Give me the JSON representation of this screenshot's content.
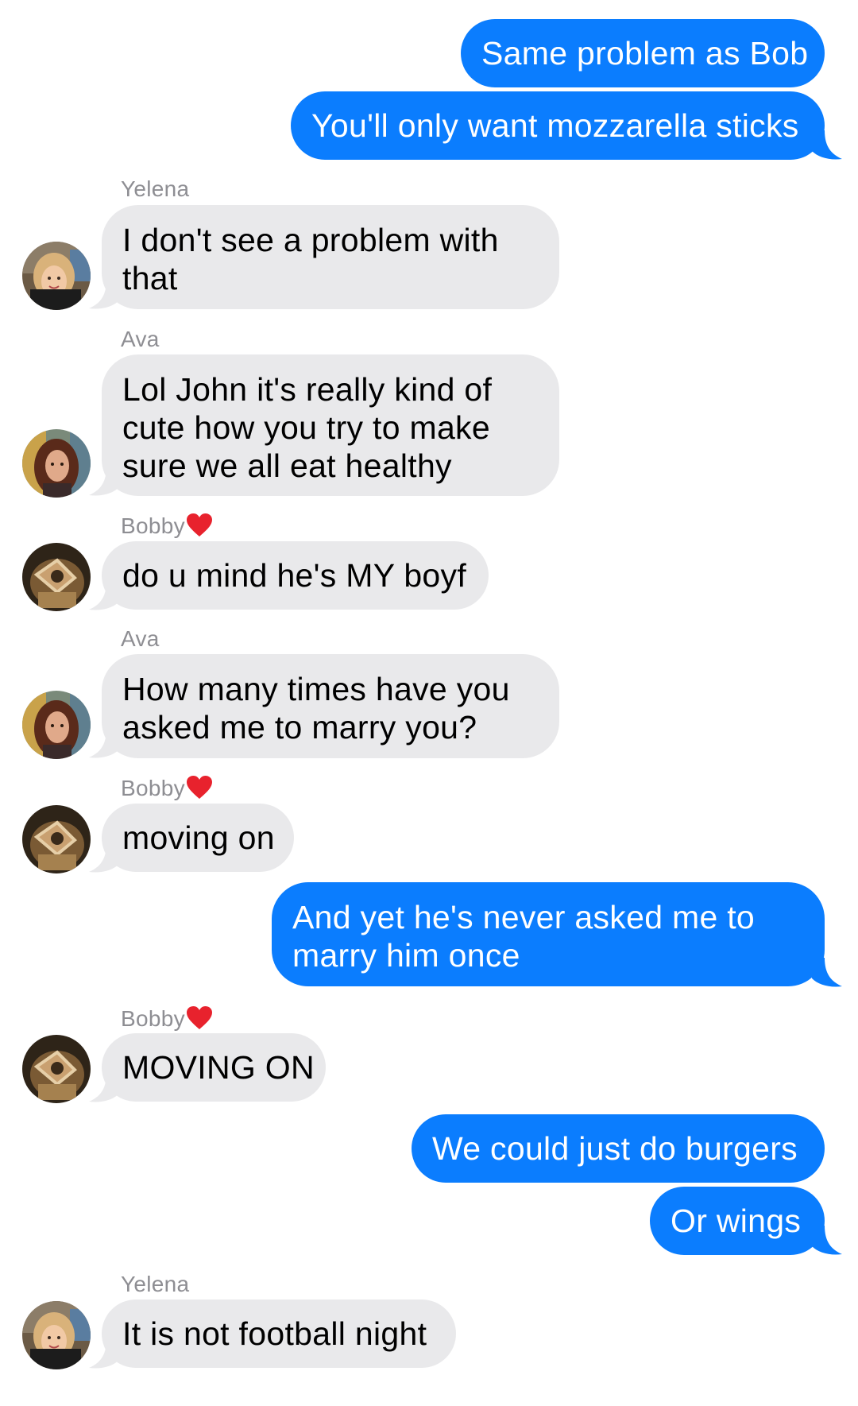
{
  "colors": {
    "outgoing_bubble": "#0b7dfe",
    "incoming_bubble": "#e9e9eb",
    "sender_name": "#8e8e93",
    "heart": "#e8222d"
  },
  "messages": [
    {
      "direction": "out",
      "text": "Same problem as Bob"
    },
    {
      "direction": "out",
      "text": "You'll only want mozzarella sticks"
    },
    {
      "direction": "in",
      "sender": "Yelena",
      "avatar": "yelena-avatar",
      "lines": [
        "I don't see a problem with",
        "that"
      ]
    },
    {
      "direction": "in",
      "sender": "Ava",
      "avatar": "ava-avatar",
      "lines": [
        "Lol John it's really kind of",
        "cute how you try to make",
        "sure we all eat healthy"
      ]
    },
    {
      "direction": "in",
      "sender": "Bobby",
      "sender_icon": "red-heart-icon",
      "avatar": "bobby-avatar",
      "lines": [
        "do u mind he's MY boyf"
      ]
    },
    {
      "direction": "in",
      "sender": "Ava",
      "avatar": "ava-avatar",
      "lines": [
        "How many times have you",
        "asked me to marry you?"
      ]
    },
    {
      "direction": "in",
      "sender": "Bobby",
      "sender_icon": "red-heart-icon",
      "avatar": "bobby-avatar",
      "lines": [
        "moving on"
      ]
    },
    {
      "direction": "out",
      "lines": [
        "And yet he's never asked me to",
        "marry him once"
      ]
    },
    {
      "direction": "in",
      "sender": "Bobby",
      "sender_icon": "red-heart-icon",
      "avatar": "bobby-avatar",
      "lines": [
        "MOVING ON"
      ]
    },
    {
      "direction": "out",
      "text": "We could just do burgers"
    },
    {
      "direction": "out",
      "text": "Or wings"
    },
    {
      "direction": "in",
      "sender": "Yelena",
      "avatar": "yelena-avatar",
      "lines": [
        "It is not football night"
      ]
    }
  ]
}
